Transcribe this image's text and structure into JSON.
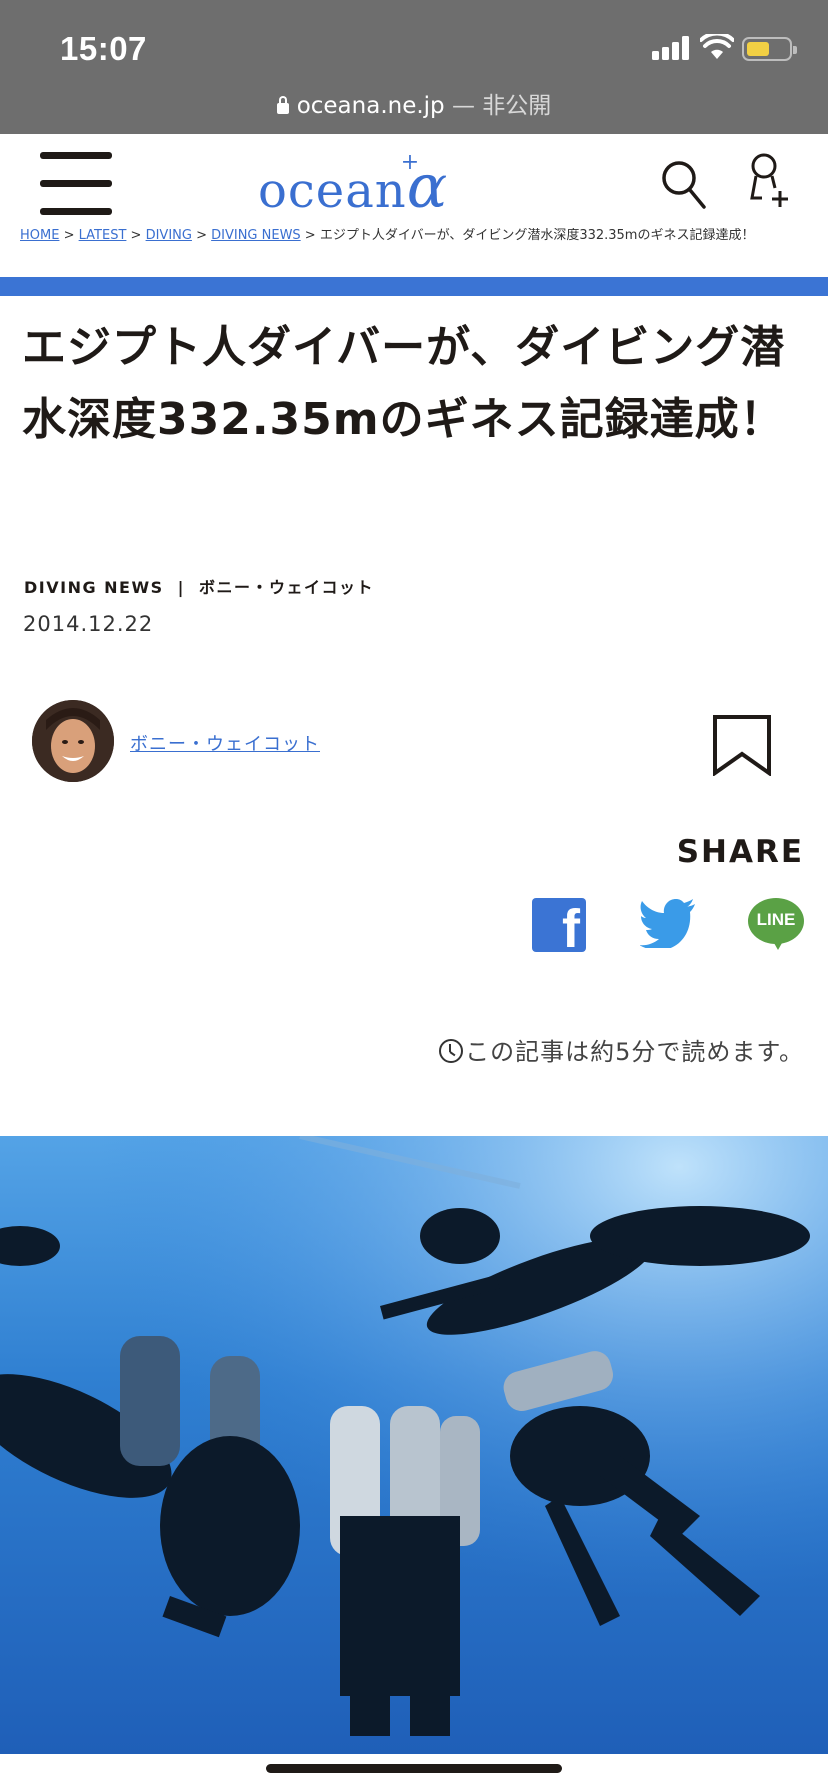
{
  "status_bar": {
    "time": "15:07",
    "battery_color": "#f2d044"
  },
  "url_bar": {
    "domain": "oceana.ne.jp",
    "suffix": " — 非公開"
  },
  "header": {
    "logo_text": "ocean",
    "logo_alpha": "α",
    "logo_plus": "+",
    "brand_color": "#3a6fd0"
  },
  "breadcrumb": {
    "items": [
      "HOME",
      "LATEST",
      "DIVING",
      "DIVING NEWS"
    ],
    "separator": " > ",
    "current": "エジプト人ダイバーが、ダイビング潜水深度332.35mのギネス記録達成！"
  },
  "article": {
    "title": "エジプト人ダイバーが、ダイビング潜水深度332.35mのギネス記録達成！",
    "category": "DIVING NEWS",
    "meta_separator": "|",
    "author": "ボニー・ウェイコット",
    "date": "2014.12.22",
    "author_link": "ボニー・ウェイコット",
    "read_time": "この記事は約5分で読めます。"
  },
  "share": {
    "label": "SHARE",
    "facebook_icon": "f",
    "line_icon": "LINE",
    "colors": {
      "facebook": "#3b74d4",
      "twitter": "#3a9be8",
      "line": "#5aa145"
    }
  },
  "icons": [
    "hamburger-icon",
    "search-icon",
    "user-add-icon",
    "bookmark-icon",
    "clock-icon",
    "facebook-icon",
    "twitter-icon",
    "line-icon"
  ]
}
